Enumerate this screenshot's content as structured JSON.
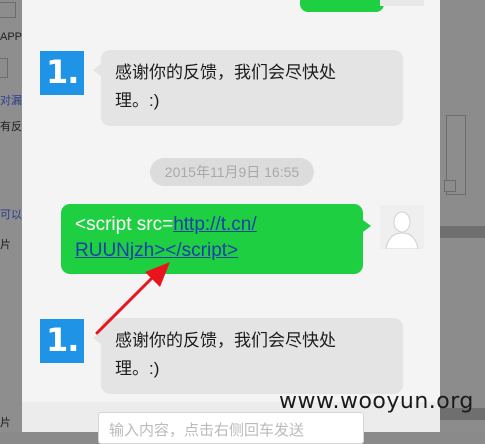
{
  "background_page": {
    "left_fragments": [
      "APP-",
      "对漏",
      "有反",
      "可以",
      "片",
      "片"
    ]
  },
  "chat": {
    "messages": [
      {
        "from": "service",
        "text_line1": "感谢你的反馈，我们会尽快处",
        "text_line2": "理。:)"
      },
      {
        "timestamp": "2015年11月9日 16:55"
      },
      {
        "from": "user",
        "text_prefix": "<script src=",
        "link_line1": "http://t.cn/",
        "link_line2": "RUUNjzh",
        "text_suffix": "></script>"
      },
      {
        "from": "service",
        "text_line1": "感谢你的反馈，我们会尽快处",
        "text_line2": "理。:)"
      }
    ],
    "logo_glyph": "1.",
    "input_placeholder": "输入内容，点击右侧回车发送"
  },
  "watermark": "www.wooyun.org",
  "colors": {
    "logo_blue": "#1f93e6",
    "user_bubble_green": "#1fcf42",
    "service_bubble_gray": "#e4e4e4",
    "link_blue": "#1d3fa6",
    "arrow_red": "#e8161c"
  },
  "icons": {
    "service_avatar": "logo-one-dot-icon",
    "user_avatar": "default-user-silhouette-icon",
    "annotation": "red-arrow-icon"
  }
}
